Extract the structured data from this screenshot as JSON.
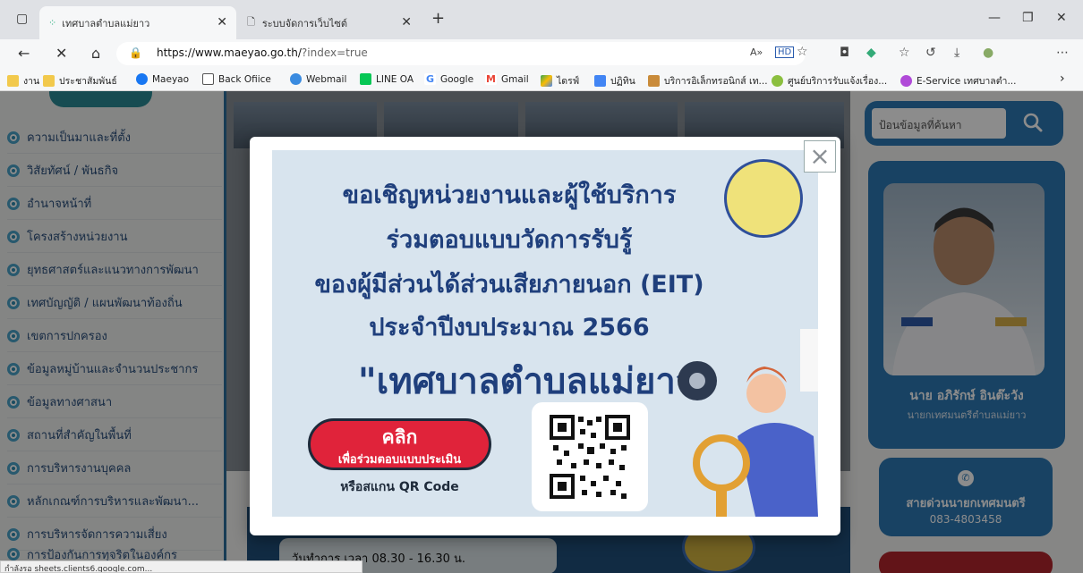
{
  "browser": {
    "tabs": [
      {
        "title": "เทศบาลตำบลแม่ยาว",
        "active": true
      },
      {
        "title": "ระบบจัดการเว็บไซต์",
        "active": false
      }
    ],
    "url_domain": "https://www.maeyao.go.th/",
    "url_rest": "?index=true",
    "favorites": [
      {
        "label": "งาน",
        "icon": "folder-icon"
      },
      {
        "label": "ประชาสัมพันธ์",
        "icon": "folder-icon"
      },
      {
        "label": "Maeyao",
        "icon": "facebook-icon"
      },
      {
        "label": "Back Ofiice",
        "icon": "page-icon"
      },
      {
        "label": "Webmail",
        "icon": "webmail-icon"
      },
      {
        "label": "LINE OA",
        "icon": "line-icon"
      },
      {
        "label": "Google",
        "icon": "google-icon"
      },
      {
        "label": "Gmail",
        "icon": "gmail-icon"
      },
      {
        "label": "ไดรฟ์",
        "icon": "drive-icon"
      },
      {
        "label": "ปฏิทิน",
        "icon": "calendar-icon"
      },
      {
        "label": "บริการอิเล็กทรอนิกส์ เท...",
        "icon": "service-icon"
      },
      {
        "label": "ศูนย์บริการรับแจ้งเรื่อง...",
        "icon": "center-icon"
      },
      {
        "label": "E-Service เทศบาลตำ...",
        "icon": "eservice-icon"
      }
    ],
    "status_text": "กำลังรอ sheets.clients6.google.com..."
  },
  "sidebar": {
    "items": [
      "ความเป็นมาและที่ตั้ง",
      "วิสัยทัศน์ / พันธกิจ",
      "อำนาจหน้าที่",
      "โครงสร้างหน่วยงาน",
      "ยุทธศาสตร์และแนวทางการพัฒนา",
      "เทศบัญญัติ / แผนพัฒนาท้องถิ่น",
      "เขตการปกครอง",
      "ข้อมูลหมู่บ้านและจำนวนประชากร",
      "ข้อมูลทางศาสนา",
      "สถานที่สำคัญในพื้นที่",
      "การบริหารงานบุคคล",
      "หลักเกณฑ์การบริหารและพัฒนา...",
      "การบริหารจัดการความเสี่ยง",
      "การป้องกันการทุจริตในองค์กร"
    ]
  },
  "search": {
    "placeholder": "ป้อนข้อมูลที่ค้นหา"
  },
  "mayor": {
    "name": "นาย อภิรักษ์ อินต๊ะวัง",
    "position": "นายกเทศมนตรีตำบลแม่ยาว"
  },
  "hotline": {
    "label": "สายด่วนนายกเทศมนตรี",
    "number": "083-4803458"
  },
  "hours": {
    "text": "วันทำการ เวลา 08.30 - 16.30 น."
  },
  "modal": {
    "line1": "ขอเชิญหน่วยงานและผู้ใช้บริการ",
    "line2": "ร่วมตอบแบบวัดการรับรู้",
    "line3": "ของผู้มีส่วนได้ส่วนเสียภายนอก (EIT)",
    "line4": "ประจำปีงบประมาณ 2566",
    "line5": "\"เทศบาลตำบลแม่ยาว\"",
    "click_main": "คลิก",
    "click_sub": "เพื่อร่วมตอบแบบประเมิน",
    "qr_caption": "หรือสแกน QR Code",
    "close": "×"
  },
  "colors": {
    "accent": "#2c78b4",
    "banner_text": "#1f3f7c",
    "click_red": "#e0233a"
  }
}
